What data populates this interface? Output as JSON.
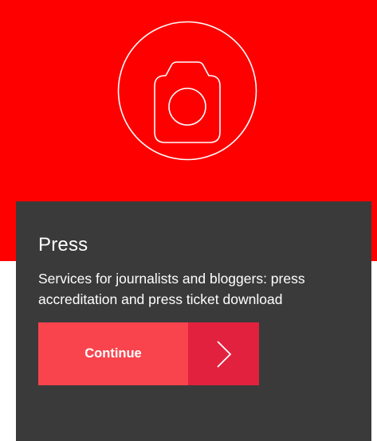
{
  "colors": {
    "hero_background": "#ff0000",
    "card_background": "#3a3a3a",
    "button_primary": "#fa444d",
    "button_secondary": "#e2213e",
    "text": "#ffffff"
  },
  "hero": {
    "icon": "camera-icon"
  },
  "card": {
    "title": "Press",
    "description": "Services for journalists and bloggers: press accreditation and press ticket download",
    "button": {
      "label": "Continue",
      "icon": "chevron-right-icon"
    }
  }
}
